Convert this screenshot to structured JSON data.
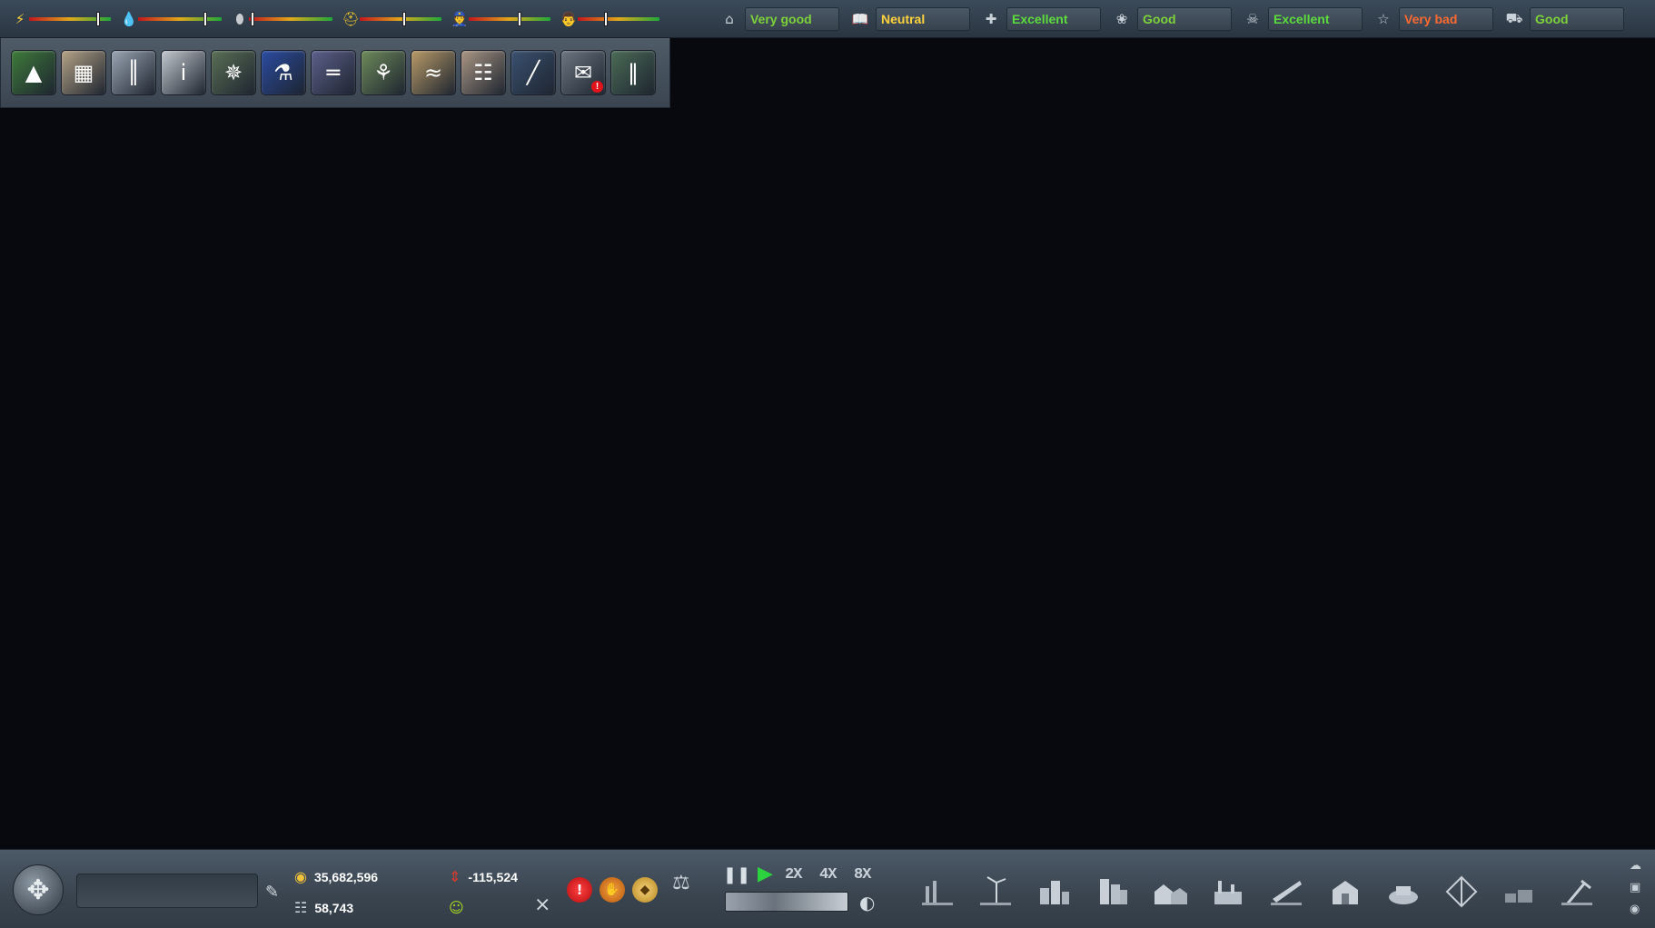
{
  "meters": [
    {
      "icon": "power-icon",
      "glyph": "⚡",
      "color": "#ffd23d",
      "level": 0.84
    },
    {
      "icon": "water-icon",
      "glyph": "💧",
      "color": "#2f8fff",
      "level": 0.8
    },
    {
      "icon": "oil-drop-icon",
      "glyph": "⬮",
      "color": "#c7cbcf",
      "level": 0.04
    },
    {
      "icon": "worker-helmet-icon",
      "glyph": "⛑",
      "color": "#e8c12a",
      "level": 0.54
    },
    {
      "icon": "police-officer-icon",
      "glyph": "👮",
      "color": "#5a6ad1",
      "level": 0.62
    },
    {
      "icon": "firefighter-icon",
      "glyph": "👨",
      "color": "#d8d8d8",
      "level": 0.34
    }
  ],
  "ratings": [
    {
      "icon": "housing-icon",
      "glyph": "⌂",
      "label": "Very good",
      "color": "#7dd23a"
    },
    {
      "icon": "education-book-icon",
      "glyph": "📖",
      "label": "Neutral",
      "color": "#ffd23d"
    },
    {
      "icon": "health-cross-icon",
      "glyph": "✚",
      "label": "Excellent",
      "color": "#5cdc3c"
    },
    {
      "icon": "parks-icon",
      "glyph": "❀",
      "label": "Good",
      "color": "#7dd23a"
    },
    {
      "icon": "safety-icon",
      "glyph": "☠",
      "label": "Excellent",
      "color": "#5cdc3c"
    },
    {
      "icon": "entertainment-icon",
      "glyph": "☆",
      "label": "Very bad",
      "color": "#ff6a30"
    },
    {
      "icon": "transport-icon",
      "glyph": "⛟",
      "label": "Good",
      "color": "#7dd23a"
    }
  ],
  "tools": [
    {
      "name": "terrain-tool",
      "glyph": "▲",
      "bg": "#3e7a3a"
    },
    {
      "name": "zoning-tool",
      "glyph": "▦",
      "bg": "#b5a387"
    },
    {
      "name": "industry-tool",
      "glyph": "║",
      "bg": "#9aa5b3"
    },
    {
      "name": "info-tool",
      "glyph": "i",
      "bg": "#c3c9cf"
    },
    {
      "name": "services-tool",
      "glyph": "✵",
      "bg": "#5a6f55"
    },
    {
      "name": "research-tool",
      "glyph": "⚗",
      "bg": "#2a4ba0"
    },
    {
      "name": "roads-tool",
      "glyph": "═",
      "bg": "#5c5f8a"
    },
    {
      "name": "parks-tool",
      "glyph": "⚘",
      "bg": "#6e8a5a"
    },
    {
      "name": "economy-tool",
      "glyph": "≈",
      "bg": "#b89a68"
    },
    {
      "name": "documents-tool",
      "glyph": "☷",
      "bg": "#a99684"
    },
    {
      "name": "transport-tool",
      "glyph": "╱",
      "bg": "#3a5170"
    },
    {
      "name": "mail-tool",
      "glyph": "✉",
      "bg": "#6c7680",
      "badge": "!"
    },
    {
      "name": "history-tool",
      "glyph": "‖",
      "bg": "#4b6b56"
    }
  ],
  "stats": {
    "money": "35,682,596",
    "population": "58,743",
    "income": "-115,524"
  },
  "speed": {
    "x2": "2X",
    "x4": "4X",
    "x8": "8X"
  },
  "build_categories": [
    "power-plant",
    "wind-power",
    "residential",
    "commercial",
    "farm",
    "industrial",
    "airport",
    "government",
    "transport-depot",
    "landmark",
    "utility",
    "demolish"
  ]
}
